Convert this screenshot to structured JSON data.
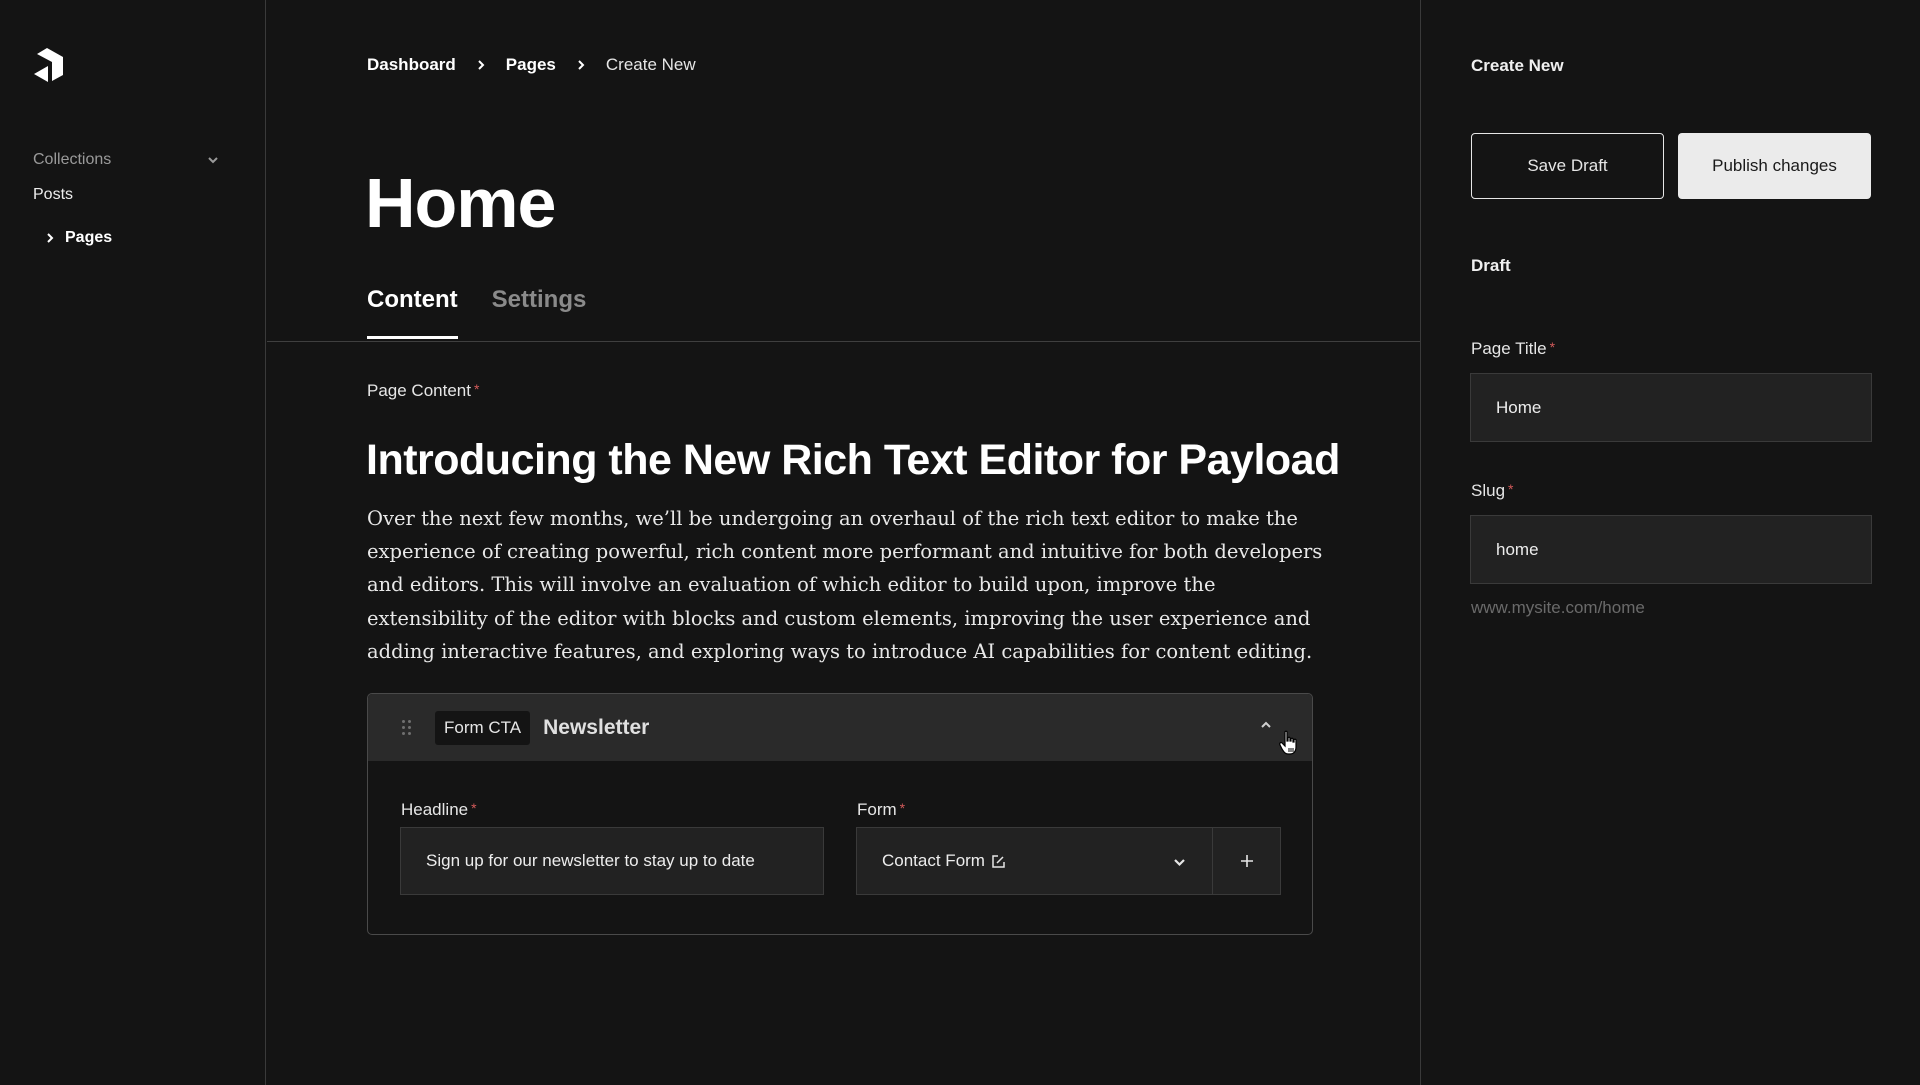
{
  "sidebar": {
    "logo": "payload-logo-icon",
    "collections_label": "Collections",
    "items": [
      {
        "label": "Posts",
        "active": false
      },
      {
        "label": "Pages",
        "active": true
      }
    ]
  },
  "breadcrumb": {
    "items": [
      "Dashboard",
      "Pages",
      "Create New"
    ]
  },
  "page": {
    "title": "Home",
    "tabs": [
      {
        "label": "Content",
        "active": true
      },
      {
        "label": "Settings",
        "active": false
      }
    ]
  },
  "content": {
    "label": "Page Content",
    "required_mark": "*",
    "heading": "Introducing the New Rich Text Editor for Payload",
    "paragraph": "Over the next few months, we’ll be undergoing an overhaul of the rich text editor to make the experience of creating powerful, rich content more performant and intuitive for both developers and editors. This will involve an evaluation of which editor to build upon, improve the extensibility of the editor with blocks and custom elements, improving the user experience and adding interactive features, and exploring ways to introduce AI capabilities for content editing.",
    "block": {
      "type_tag": "Form CTA",
      "name": "Newsletter",
      "collapsed": false,
      "fields": {
        "headline_label": "Headline",
        "headline_value": "Sign up for our newsletter to stay up to date",
        "form_label": "Form",
        "form_value": "Contact Form",
        "add_label": "+"
      }
    }
  },
  "right_panel": {
    "title": "Create New",
    "save_draft_label": "Save Draft",
    "publish_label": "Publish changes",
    "status": "Draft",
    "page_title_label": "Page Title",
    "page_title_value": "Home",
    "slug_label": "Slug",
    "slug_value": "home",
    "url_preview": "www.mysite.com/home"
  },
  "colors": {
    "background": "#141414",
    "input_bg": "#222222",
    "border": "#3a3a3a",
    "required": "#d25a5a",
    "publish_bg": "#ebebeb"
  }
}
